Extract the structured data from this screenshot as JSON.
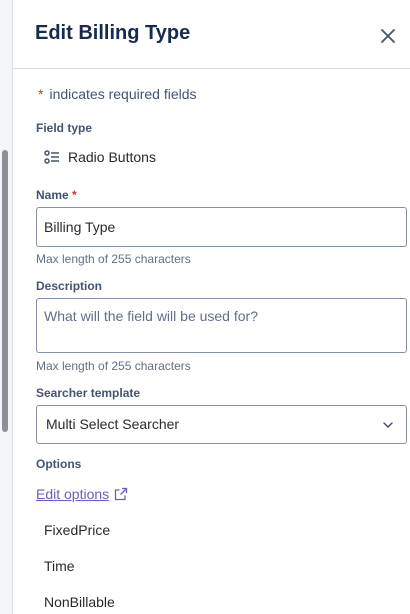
{
  "dialog": {
    "title": "Edit Billing Type",
    "required_star": "*",
    "required_note": "indicates required fields"
  },
  "field_type": {
    "label": "Field type",
    "value": "Radio Buttons",
    "icon": "list-icon"
  },
  "name_field": {
    "label": "Name",
    "required_star": "*",
    "value": "Billing Type",
    "helper": "Max length of 255 characters"
  },
  "description_field": {
    "label": "Description",
    "placeholder": "What will the field will be used for?",
    "helper": "Max length of 255 characters"
  },
  "searcher_template": {
    "label": "Searcher template",
    "selected": "Multi Select Searcher"
  },
  "options": {
    "label": "Options",
    "edit_link": "Edit options",
    "items": [
      "FixedPrice",
      "Time",
      "NonBillable"
    ]
  },
  "colors": {
    "required": "#c9372c",
    "link": "#6e5dc6",
    "border": "#8590a2"
  }
}
